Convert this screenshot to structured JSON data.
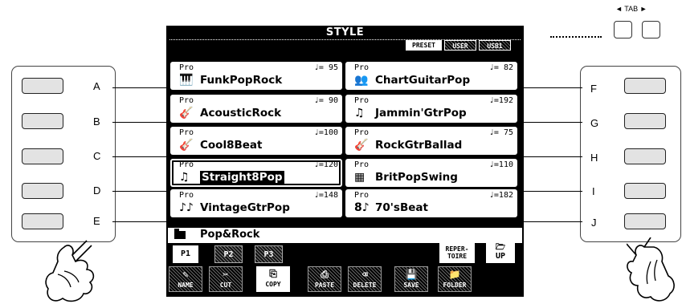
{
  "screen": {
    "title": "STYLE",
    "source_tabs": [
      {
        "label": "PRESET",
        "active": true
      },
      {
        "label": "USER",
        "active": false
      },
      {
        "label": "USB1",
        "active": false
      }
    ],
    "styles": [
      {
        "pro": "Pro",
        "tempo": "♩= 95",
        "name": "FunkPopRock",
        "icon": "keyboard-icon"
      },
      {
        "pro": "Pro",
        "tempo": "♩= 90",
        "name": "AcousticRock",
        "icon": "acoustic-guitar-icon"
      },
      {
        "pro": "Pro",
        "tempo": "♩=100",
        "name": "Cool8Beat",
        "icon": "electric-guitar-icon"
      },
      {
        "pro": "Pro",
        "tempo": "♩=120",
        "name": "Straight8Pop",
        "icon": "note-icon",
        "selected": true
      },
      {
        "pro": "Pro",
        "tempo": "♩=148",
        "name": "VintageGtrPop",
        "icon": "notes-icon"
      },
      {
        "pro": "Pro",
        "tempo": "♩= 82",
        "name": "ChartGuitarPop",
        "icon": "people-icon"
      },
      {
        "pro": "Pro",
        "tempo": "♩=192",
        "name": "Jammin'GtrPop",
        "icon": "dancer-icon"
      },
      {
        "pro": "Pro",
        "tempo": "♩= 75",
        "name": "RockGtrBallad",
        "icon": "bass-guitar-icon"
      },
      {
        "pro": "Pro",
        "tempo": "♩=110",
        "name": "BritPopSwing",
        "icon": "union-jack-icon"
      },
      {
        "pro": "Pro",
        "tempo": "♩=182",
        "name": "70'sBeat",
        "icon": "eight-note-icon",
        "prefix": "8♪"
      }
    ],
    "folder": "Pop&Rock",
    "pages": [
      {
        "label": "P1",
        "active": true
      },
      {
        "label": "P2",
        "active": false
      },
      {
        "label": "P3",
        "active": false
      }
    ],
    "repertoire_label": [
      "REPER-",
      "TOIRE"
    ],
    "up_label": "UP",
    "functions": [
      {
        "label": "NAME",
        "active": false
      },
      {
        "label": "CUT",
        "active": false
      },
      {
        "label": "COPY",
        "active": true
      },
      {
        "label": "PASTE",
        "active": false
      },
      {
        "label": "DELETE",
        "active": false
      },
      {
        "label": "SAVE",
        "active": false
      },
      {
        "label": "FOLDER",
        "active": false
      }
    ]
  },
  "left_buttons": [
    "A",
    "B",
    "C",
    "D",
    "E"
  ],
  "right_buttons": [
    "F",
    "G",
    "H",
    "I",
    "J"
  ],
  "tab_label": "◄ TAB ►"
}
